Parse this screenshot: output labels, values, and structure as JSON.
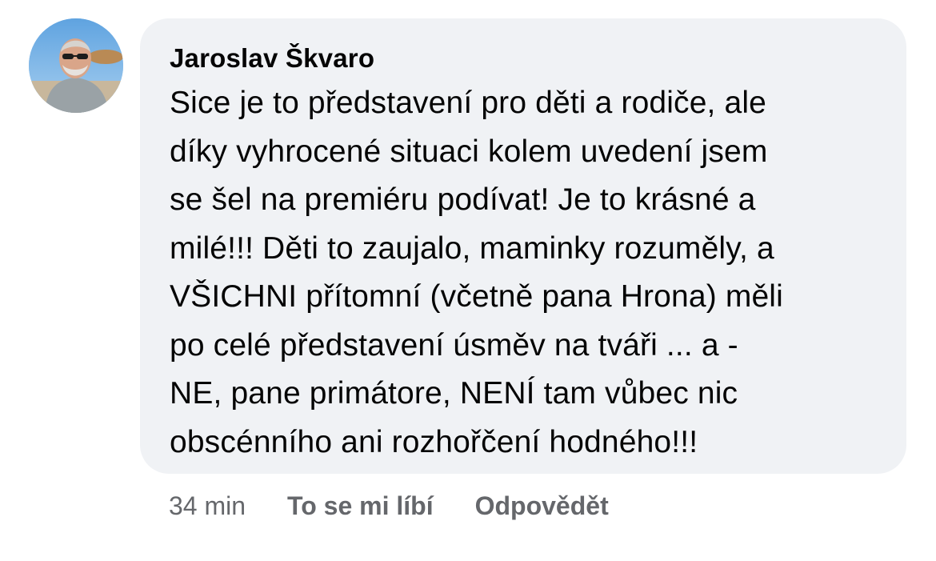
{
  "comment": {
    "author": "Jaroslav Škvaro",
    "text": "Sice je to představení pro děti a rodiče, ale\ndíky vyhrocené situaci kolem uvedení jsem\nse šel na premiéru podívat! Je to krásné a\nmilé!!! Děti to zaujalo, maminky rozuměly, a\nVŠICHNI přítomní (včetně pana Hrona) měli\npo celé představení úsměv na tváři ... a  -\nNE, pane primátore, NENÍ tam vůbec nic\nobscénního ani rozhořčení hodného!!!",
    "time": "34 min",
    "like_label": "To se mi líbí",
    "reply_label": "Odpovědět"
  },
  "colors": {
    "bubble": "#f0f2f5",
    "text": "#050505",
    "meta": "#65676b"
  }
}
